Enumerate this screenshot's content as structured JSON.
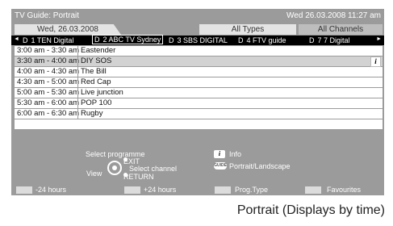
{
  "title_bar": {
    "app_title": "TV Guide: Portrait",
    "datetime": "Wed 26.03.2008 11:27 am"
  },
  "tabs": {
    "date": "Wed, 26.03.2008",
    "types": "All Types",
    "channels": "All Channels"
  },
  "channel_bar": {
    "left_arrow": "◄",
    "right_arrow": "►",
    "channels": [
      {
        "prefix": "D",
        "label": "1 TEN Digital"
      },
      {
        "prefix": "D",
        "label": "2 ABC TV Sydney"
      },
      {
        "prefix": "D",
        "label": "3 SBS DIGITAL"
      },
      {
        "prefix": "D",
        "label": "4 FTV guide"
      },
      {
        "prefix": "D",
        "label": "7 7 Digital"
      }
    ]
  },
  "programmes": [
    {
      "time": "3:00 am - 3:30 am",
      "title": "Eastender"
    },
    {
      "time": "3:30 am - 4:00 am",
      "title": "DIY SOS"
    },
    {
      "time": "4:00 am - 4:30 am",
      "title": "The Bill"
    },
    {
      "time": "4:30 am - 5:00 am",
      "title": "Red Cap"
    },
    {
      "time": "5:00 am - 5:30 am",
      "title": "Live junction"
    },
    {
      "time": "5:30 am - 6:00 am",
      "title": "POP 100"
    },
    {
      "time": "6:00 am - 6:30 am",
      "title": "Rugby"
    },
    {
      "time": "",
      "title": ""
    }
  ],
  "selected_row_info_icon": "i",
  "help": {
    "select_programme": "Select programme",
    "view": "View",
    "exit": "EXIT",
    "select_channel": "Select channel",
    "return": "RETURN",
    "info_key": "i",
    "info": "Info",
    "guide_key": "GUIDE",
    "portrait_landscape": "Portrait/Landscape"
  },
  "footer": {
    "minus24": "-24 hours",
    "plus24": "+24 hours",
    "prog_type": "Prog.Type",
    "favourites": "Favourites"
  },
  "caption": "Portrait (Displays by time)",
  "colors": {
    "panel": "#9b9b9b",
    "channel_bar": "#000000",
    "row": "#ffffff",
    "selected_row": "#d2d2d2"
  }
}
